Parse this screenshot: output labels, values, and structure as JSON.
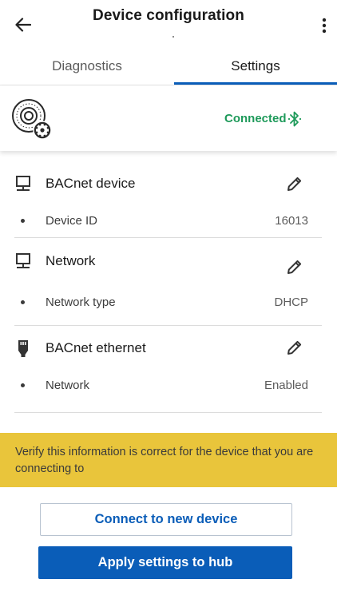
{
  "header": {
    "title": "Device configuration",
    "back_icon": "arrow-left-icon",
    "more_icon": "more-vertical-icon"
  },
  "tabs": [
    {
      "label": "Diagnostics",
      "active": false
    },
    {
      "label": "Settings",
      "active": true
    }
  ],
  "device": {
    "icon": "device-gear-icon",
    "status": "Connected",
    "status_icon": "bluetooth-icon"
  },
  "sections": [
    {
      "title": "BACnet device",
      "icon": "monitor-icon",
      "rows": [
        {
          "label": "Device ID",
          "value": "16013"
        }
      ]
    },
    {
      "title": "Network",
      "icon": "monitor-icon",
      "rows": [
        {
          "label": "Network type",
          "value": "DHCP"
        }
      ]
    },
    {
      "title": "BACnet ethernet",
      "icon": "ethernet-plug-icon",
      "rows": [
        {
          "label": "Network",
          "value": "Enabled"
        }
      ]
    }
  ],
  "banner": {
    "text": "Verify this information is correct for the device that you are connecting to"
  },
  "actions": {
    "connect_new": "Connect to new device",
    "apply": "Apply settings to hub"
  },
  "colors": {
    "primary": "#0a5db8",
    "connected": "#1e9a5a",
    "banner": "#e9c53b"
  }
}
